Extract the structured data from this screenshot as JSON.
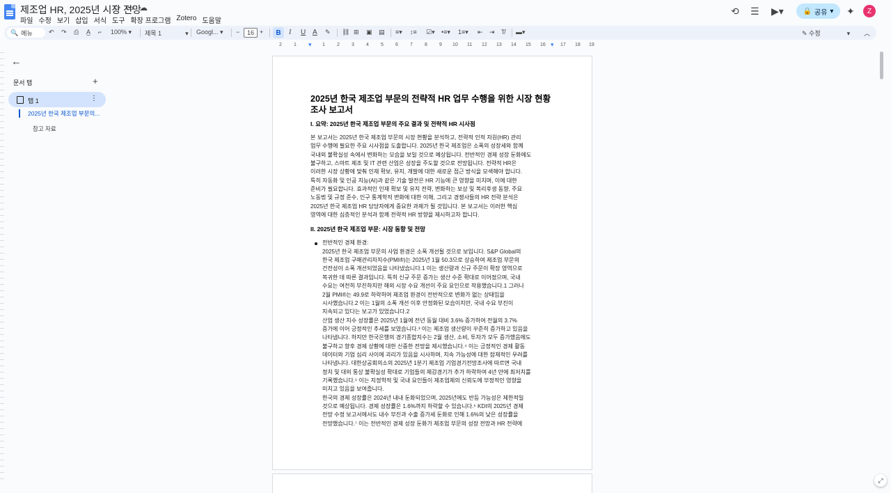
{
  "doc_title": "제조업 HR, 2025년 시장 전망",
  "menu": [
    "파일",
    "수정",
    "보기",
    "삽입",
    "서식",
    "도구",
    "확장 프로그램",
    "Zotero",
    "도움말"
  ],
  "share_label": "공유",
  "avatar_letter": "Z",
  "toolbar": {
    "search_label": "메뉴",
    "zoom": "100%",
    "style": "제목 1",
    "font": "Googl...",
    "font_size": "16",
    "mode": "수정"
  },
  "ruler": [
    "2",
    "1",
    "1",
    "2",
    "3",
    "4",
    "5",
    "6",
    "7",
    "8",
    "9",
    "10",
    "11",
    "12",
    "13",
    "14",
    "15",
    "16",
    "17",
    "18",
    "19"
  ],
  "sidebar": {
    "tabs_header": "문서 탭",
    "tab1_label": "탭 1",
    "outline": [
      "2025년 한국 제조업 부문의...",
      "참고 자료"
    ]
  },
  "document": {
    "title_lines": [
      "2025년 한국 제조업 부문의 전략적 HR 업무 수행을 위한 시장 현황",
      "조사 보고서"
    ],
    "h_summary": "I. 요약: 2025년 한국 제조업 부문의 주요 결과 및 전략적 HR 시사점",
    "summary_lines": [
      "본 보고서는 2025년 한국 제조업 부문의 시장 현황을 분석하고, 전략적 인적 자원(HR) 관리",
      "업무 수행에 필요한 주요 시사점을 도출합니다. 2025년 한국 제조업은 소폭의 성장세와 함께",
      "국내외 불확실성 속에서 변화하는 모습을 보일 것으로 예상됩니다. 전반적인 경제 성장 둔화에도",
      "불구하고, 스마트 제조 및 IT 관련 산업은 성장을 주도할 것으로 전망됩니다. 전략적 HR은",
      "이러한 시장 상황에 맞춰 인재 확보, 유지, 개발에 대한 새로운 접근 방식을 모색해야 합니다.",
      "특히 자동화 및 인공 지능(AI)과 같은 기술 발전은 HR 기능에 큰 영향을 미치며, 이에 대한",
      "준비가 필요합니다. 효과적인 인재 확보 및 유지 전략, 변화하는 보상 및 복리후생 동향, 주요",
      "노동법 및 규정 준수, 인구 통계학적 변화에 대한 이해, 그리고 경쟁사들의 HR 전략 분석은",
      "2025년 한국 제조업 HR 담당자에게 중요한 과제가 될 것입니다. 본 보고서는 이러한 핵심",
      "영역에 대한 심층적인 분석과 함께 전략적 HR 방향을 제시하고자 합니다."
    ],
    "h_market": "II. 2025년 한국 제조업 부문: 시장 동향 및 전망",
    "bullet_title": "전반적인 경제 환경:",
    "bullet_lines": [
      "2025년 한국 제조업 부문의 사업 환경은 소폭 개선될 것으로 보입니다. S&P Global의",
      "한국 제조업 구매관리자지수(PMI®)는 2025년 1월 50.3으로 상승하여 제조업 부문의",
      "건전성이 소폭 개선되었음을 나타냈습니다.1 이는 생산량과 신규 주문이 확장 영역으로",
      "복귀한 데 따른 결과입니다. 특히 신규 주문 증가는 생산 수준 확대로 이어졌으며, 국내",
      "수요는 여전히 부진하지만 해외 시장 수요 개선이 주요 요인으로 작용했습니다.1 그러나",
      "2월 PMI®는 49.9로 하락하여 제조업 환경이 전반적으로 변화가 없는 상태임을",
      "시사했습니다.2 이는 1월의 소폭 개선 이후 안정화된 모습이지만, 국내 수요 부진이",
      "지속되고 있다는 보고가 있었습니다.2",
      "산업 생산 지수 성장률은 2025년 1월에 전년 동월 대비 3.6% 증가하여 전월의 3.7%",
      "증가에 이어 긍정적인 추세를 보였습니다.³ 이는 제조업 생산량이 꾸준히 증가하고 있음을",
      "나타냅니다. 하지만 한국은행의 경기종합지수는 2월 생산, 소비, 투자가 모두 증가했음에도",
      "불구하고 향후 경제 상황에 대한 신중한 전망을 제시했습니다.⁴ 이는 긍정적인 경제 활동",
      "데이터와 기업 심리 사이에 괴리가 있음을 시사하며, 지속 가능성에 대한 잠재적인 우려를",
      "나타냅니다. 대한상공회의소의 2025년 1분기 제조업 기업경기전망조사에 따르면 국내",
      "정치 및 대외 통상 불확실성 확대로 기업들의 체감경기가 추가 하락하여 4년 만에 최저치를",
      "기록했습니다.⁵ 이는 지정학적 및 국내 요인들이 제조업체의 신뢰도에 부정적인 영향을",
      "미치고 있음을 보여줍니다.",
      "한국의 경제 성장률은 2024년 내내 둔화되었으며, 2025년에도 반등 가능성은 제한적일",
      "것으로 예상됩니다. 경제 성장률은 1.6%까지 하락할 수 있습니다.⁶ KDI의 2025년 경제",
      "전망 수정 보고서에서도 내수 부진과 수출 증가세 둔화로 인해 1.6%의 낮은 성장률을",
      "전망했습니다.⁷ 이는 전반적인 경제 성장 둔화가 제조업 부문의 성장 전망과 HR 전략에"
    ]
  }
}
